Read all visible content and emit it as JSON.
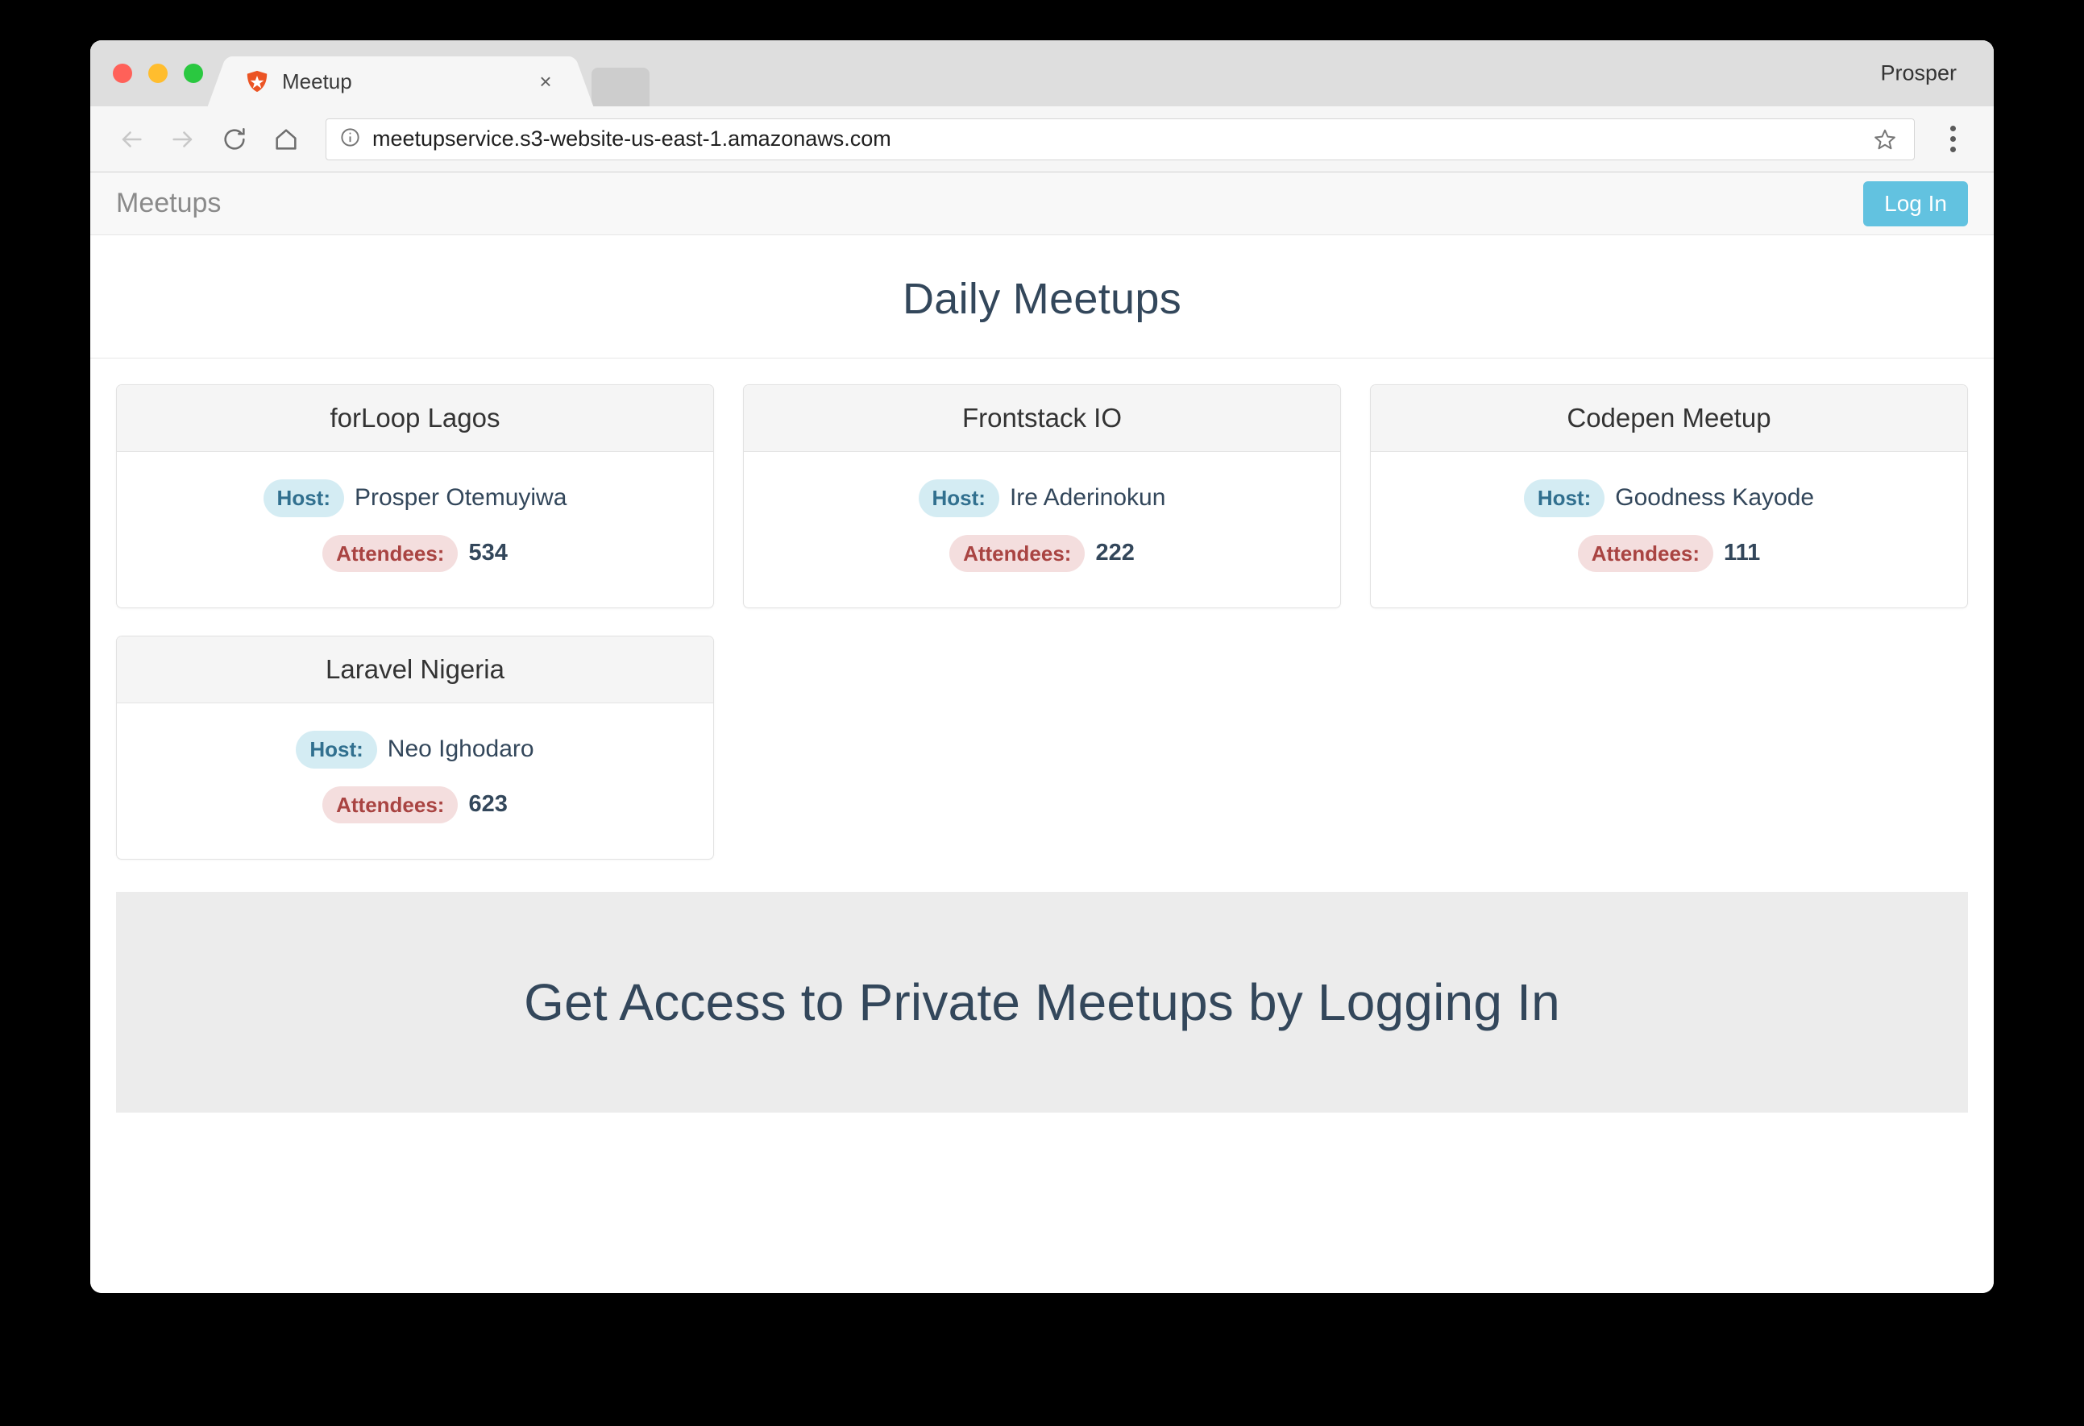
{
  "browser": {
    "tab": {
      "title": "Meetup",
      "favicon": "auth0-shield-icon",
      "close_label": "×"
    },
    "profile_name": "Prosper",
    "url": "meetupservice.s3-website-us-east-1.amazonaws.com",
    "toolbar": {
      "back": "back-arrow-icon",
      "forward": "forward-arrow-icon",
      "reload": "reload-icon",
      "home": "home-icon",
      "info": "info-icon",
      "bookmark": "star-icon",
      "menu": "three-dot-menu-icon"
    }
  },
  "app": {
    "brand": "Meetups",
    "login_label": "Log In",
    "page_title": "Daily Meetups",
    "labels": {
      "host": "Host:",
      "attendees": "Attendees:"
    },
    "meetups": [
      {
        "name": "forLoop Lagos",
        "host": "Prosper Otemuyiwa",
        "attendees": "534"
      },
      {
        "name": "Frontstack IO",
        "host": "Ire Aderinokun",
        "attendees": "222"
      },
      {
        "name": "Codepen Meetup",
        "host": "Goodness Kayode",
        "attendees": "111"
      },
      {
        "name": "Laravel Nigeria",
        "host": "Neo Ighodaro",
        "attendees": "623"
      }
    ],
    "jumbotron_title": "Get Access to Private Meetups by Logging In"
  },
  "colors": {
    "accent": "#62c2e0",
    "heading": "#33475b",
    "host_pill_bg": "#d4ecf3",
    "host_pill_text": "#31708f",
    "attendees_pill_bg": "#f4dede",
    "attendees_pill_text": "#a94442",
    "jumbotron_bg": "#ececec"
  }
}
